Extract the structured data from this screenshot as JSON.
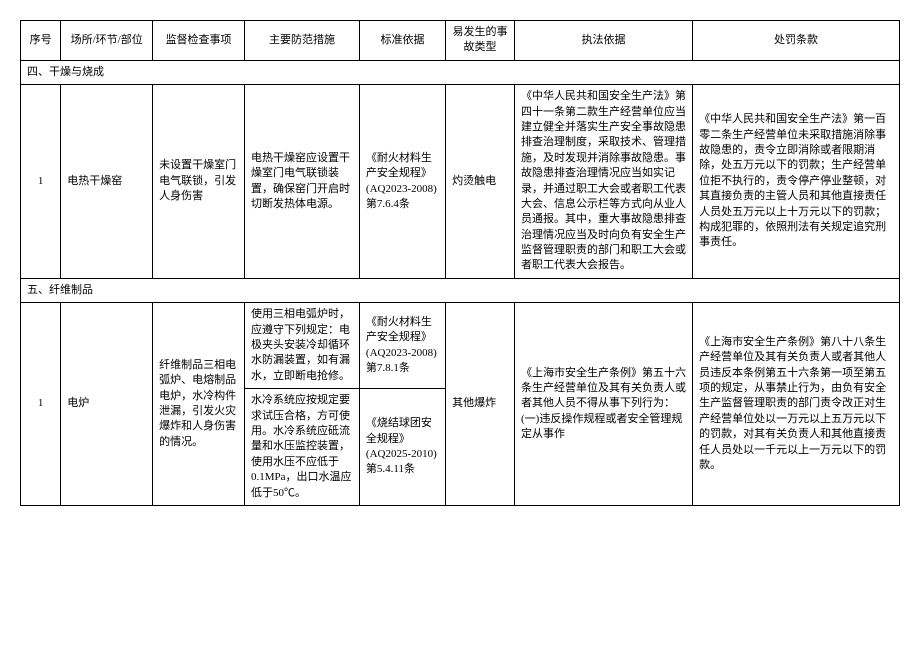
{
  "headers": {
    "seq": "序号",
    "place": "场所/环节/部位",
    "inspect": "监督检查事项",
    "measure": "主要防范措施",
    "standard": "标准依据",
    "accident": "易发生的事故类型",
    "enforce": "执法依据",
    "penalty": "处罚条款"
  },
  "section4": {
    "title": "四、干燥与烧成",
    "rows": [
      {
        "seq": "1",
        "place": "电热干燥窑",
        "inspect": "未设置干燥室门电气联锁，引发人身伤害",
        "measure": "电热干燥窑应设置干燥室门电气联锁装置，确保窑门开启时切断发热体电源。",
        "standard": "《耐火材料生产安全规程》(AQ2023-2008)第7.6.4条",
        "accident": "灼烫触电",
        "enforce": "《中华人民共和国安全生产法》第四十一条第二款生产经营单位应当建立健全并落实生产安全事故隐患排查治理制度，采取技术、管理措施，及时发现并消除事故隐患。事故隐患排查治理情况应当如实记录，并通过职工大会或者职工代表大会、信息公示栏等方式向从业人员通报。其中，重大事故隐患排查治理情况应当及时向负有安全生产监督管理职责的部门和职工大会或者职工代表大会报告。",
        "penalty": "《中华人民共和国安全生产法》第一百零二条生产经营单位未采取措施消除事故隐患的，责令立即消除或者限期消除，处五万元以下的罚款；生产经营单位拒不执行的，责令停产停业整顿，对其直接负责的主管人员和其他直接责任人员处五万元以上十万元以下的罚款；构成犯罪的，依照刑法有关规定追究刑事责任。"
      }
    ]
  },
  "section5": {
    "title": "五、纤维制品",
    "rows": [
      {
        "seq": "1",
        "place": "电炉",
        "inspect": "纤维制品三相电弧炉、电熔制品电炉，水冷构件泄漏，引发火灾爆炸和人身伤害的情况。",
        "measures": [
          "使用三相电弧炉时，应遵守下列规定：电极夹头安装冷却循环水防漏装置，如有漏水，立即断电抢修。",
          "水冷系统应按规定要求试压合格，方可使用。水冷系统应砥流量和水压监控装置，使用水压不应低于0.1MPa，出口水温应低于50℃。"
        ],
        "standards": [
          "《耐火材料生产安全规程》(AQ2023-2008)第7.8.1条",
          "《烧结球团安全规程》(AQ2025-2010)第5.4.11条"
        ],
        "accident": "其他爆炸",
        "enforce": "《上海市安全生产条例》第五十六条生产经营单位及其有关负责人或者其他人员不得从事下列行为：(一)违反操作规程或者安全管理规定从事作",
        "penalty": "《上海市安全生产条例》第八十八条生产经营单位及其有关负责人或者其他人员违反本条例第五十六条第一项至第五项的规定，从事禁止行为，由负有安全生产监督管理职责的部门责令改正对生产经营单位处以一万元以上五万元以下的罚款，对其有关负责人和其他直接责任人员处以一千元以上一万元以下的罚款。"
      }
    ]
  }
}
